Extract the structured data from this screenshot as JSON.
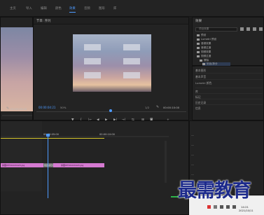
{
  "menubar": {
    "items": [
      "主页",
      "导入",
      "编辑",
      "颜色",
      "效果",
      "音频",
      "图形",
      "库"
    ],
    "active_index": 4
  },
  "source_panel": {
    "time": "00:00:00:00"
  },
  "program_panel": {
    "title": "节目: 序列",
    "current_time": "00:00:04:21",
    "fit": "50%",
    "scale": "1/2",
    "duration": "00:00:10:00",
    "transport": [
      "▼",
      "{",
      "|←",
      "◀",
      "▶",
      "▶|",
      "→|",
      "⇆",
      "⊞",
      "◙",
      "+"
    ]
  },
  "project_panel": {
    "title": "效果",
    "search_placeholder": "项目效果",
    "tree": [
      {
        "label": "预设",
        "selected": false
      },
      {
        "label": "Lumetri 预设",
        "selected": false
      },
      {
        "label": "音频效果",
        "selected": false
      },
      {
        "label": "音频过渡",
        "selected": false
      },
      {
        "label": "视频效果",
        "selected": false
      },
      {
        "label": "视频过渡",
        "selected": false
      },
      {
        "label": "擦除",
        "selected": false
      },
      {
        "label": "划出/拆分",
        "selected": true
      }
    ]
  },
  "effects_list": {
    "rows": [
      "基本图形",
      "基本声音",
      "Lumetri 颜色",
      "库",
      "标记",
      "历史记录",
      "信息"
    ]
  },
  "timeline": {
    "timecode_left": "00:00:05:00",
    "timecode_right": "00:00:10:00",
    "clip_left_label": "拼图PPT20220420.jpg",
    "clip_right_label": "拼图PPT20220420.jpg",
    "transition_label": "划出/拆分"
  },
  "taskbar": {
    "time": "14:21",
    "date": "2021/10/11"
  },
  "watermark": "最需教育"
}
